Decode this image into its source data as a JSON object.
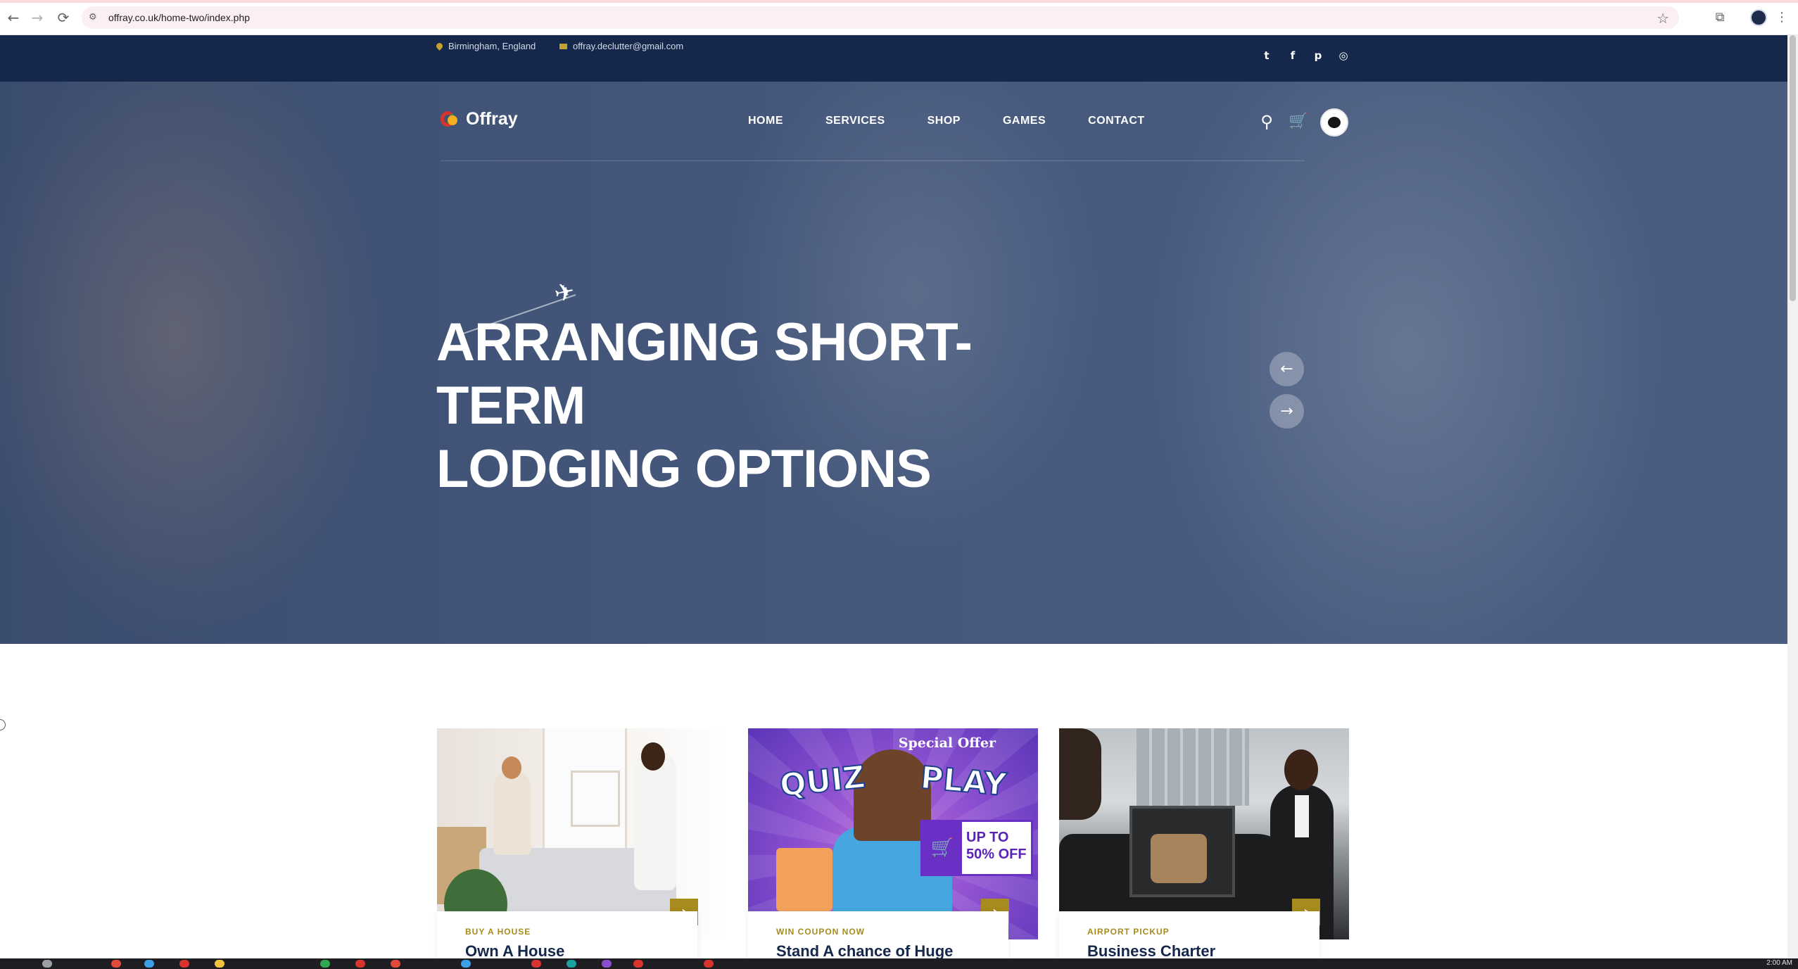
{
  "browser": {
    "url": "offray.co.uk/home-two/index.php",
    "back_icon": "←",
    "forward_icon": "→",
    "reload_icon": "⟳",
    "site_info_icon": "⚙",
    "bookmark_icon": "☆",
    "extensions_icon": "⧉",
    "menu_icon": "⋮"
  },
  "topbar": {
    "location": "Birmingham, England",
    "email": "offray.declutter@gmail.com",
    "social": [
      "t",
      "f",
      "p",
      "◎"
    ]
  },
  "header": {
    "logo_text": "Offray",
    "menu": [
      "HOME",
      "SERVICES",
      "SHOP",
      "GAMES",
      "CONTACT"
    ],
    "search_icon": "⚲",
    "cart_icon": "🛒"
  },
  "hero": {
    "headline_lines": [
      "ARRANGING SHORT-",
      "TERM",
      "LODGING OPTIONS"
    ],
    "prev_icon": "←",
    "next_icon": "→"
  },
  "cards": [
    {
      "tag": "BUY A HOUSE",
      "title": "Own A House",
      "arrow": "›"
    },
    {
      "tag": "WIN COUPON NOW",
      "title": "Stand A chance of Huge",
      "arrow": "›",
      "image_text": {
        "special": "Special Offer",
        "quiz": "QUIZ",
        "play": "PLAY",
        "offer_line1": "UP TO",
        "offer_line2": "50% OFF"
      }
    },
    {
      "tag": "AIRPORT PICKUP",
      "title": "Business Charter",
      "arrow": "›"
    }
  ],
  "taskbar": {
    "clock": "2:00 AM"
  },
  "colors": {
    "navy": "#15284b",
    "gold": "#a78b1f",
    "white": "#ffffff"
  }
}
